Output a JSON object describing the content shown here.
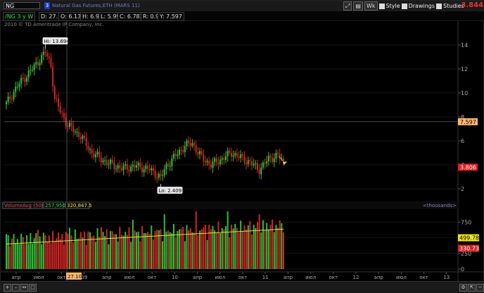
{
  "toolbar": {
    "symbol": "NG",
    "link_number": "3",
    "description": "Natural Gas Futures,ETH (MARS 11)",
    "chart_type_btn": "Wk",
    "style_label": "Style",
    "drawings_label": "Drawings",
    "studies_label": "Studies",
    "last_price": "3.844"
  },
  "info": {
    "period": "/NG 3 y W",
    "date": "D: 27.10.08",
    "open": "O: 6.133",
    "high": "H: 6.9",
    "low": "L: 5.99",
    "close": "C: 6.783",
    "range": "R: 0.91",
    "ypos": "Y: 7.597"
  },
  "copyright": "2010 © TD Ameritrade IP Company, Inc.",
  "chart_data": [
    {
      "type": "candlestick",
      "y_ticks": [
        "2",
        "4",
        "6",
        "8",
        "10",
        "12",
        "14"
      ],
      "ylim": [
        1.3,
        15.4
      ],
      "hi_label": "Hi: 13.694",
      "lo_label": "Lo: 2.409",
      "crosshair_price": "7.597",
      "current_price_label": "3.806",
      "hi": 13.694,
      "lo": 2.409,
      "crosshair_y": 7.597,
      "current_price": 3.806,
      "colors": {
        "up": "#2fbf3a",
        "down": "#d22525",
        "grid": "#2b2b2b",
        "crosshair": "#7a7a7a",
        "label_bg": "#ffb86c",
        "current_bg": "#e02020"
      }
    },
    {
      "type": "bar",
      "study_name": "VolumeAvg (50)",
      "values_shown": [
        "257,950",
        "320,847.5"
      ],
      "units": "<thousands>",
      "y_ticks": [
        "0",
        "250",
        "500",
        "750"
      ],
      "ylim": [
        0,
        900
      ],
      "avg_label": "499.78",
      "last_vol_label": "330.73",
      "avg_value": 499.78,
      "last_vol_value": 330.73,
      "colors": {
        "up": "#2fbf3a",
        "down": "#d22525",
        "avg": "#e8e337",
        "avg_bg": "#f0e51e",
        "last_bg": "#d22525"
      }
    }
  ],
  "x_axis": {
    "labels": [
      "апр",
      "июл",
      "окт",
      "09",
      "апр",
      "июл",
      "окт",
      "10",
      "апр",
      "июл",
      "окт",
      "11",
      "апр",
      "июл",
      "окт",
      "12",
      "апр",
      "июл",
      "окт",
      "13"
    ],
    "crosshair_label": "27.10"
  },
  "bottom": {
    "zoom_plus": "+",
    "zoom_minus": "–",
    "pan": "↔"
  }
}
